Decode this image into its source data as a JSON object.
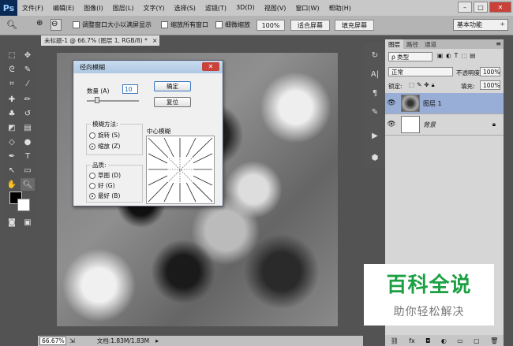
{
  "app": {
    "logo": "Ps",
    "menu": [
      "文件(F)",
      "编辑(E)",
      "图像(I)",
      "图层(L)",
      "文字(Y)",
      "选择(S)",
      "滤镜(T)",
      "3D(D)",
      "视图(V)",
      "窗口(W)",
      "帮助(H)"
    ],
    "window_controls": {
      "minimize": "–",
      "restore": "□",
      "close": "✕"
    }
  },
  "options": {
    "resize_windows": "调整窗口大小以满屏显示",
    "zoom_all": "缩放所有窗口",
    "scrubby_zoom": "细微缩放",
    "btn_100": "100%",
    "btn_fit": "适合屏幕",
    "btn_fill": "填充屏幕",
    "workspace": "基本功能"
  },
  "document": {
    "tab_title": "未标题-1 @ 66.7% (图层 1, RGB/8) *",
    "tab_close": "×",
    "zoom": "66.67%",
    "doc_info": "文档:1.83M/1.83M"
  },
  "layers_panel": {
    "tabs": [
      "图层",
      "路径",
      "通道"
    ],
    "filter_kind": "ρ 类型",
    "blend_mode": "正常",
    "opacity_label": "不透明度:",
    "opacity_value": "100%",
    "lock_label": "锁定:",
    "fill_label": "填充:",
    "fill_value": "100%",
    "layers": [
      {
        "name": "图层 1",
        "selected": true
      },
      {
        "name": "背景",
        "selected": false,
        "locked": true
      }
    ],
    "footer_icons": [
      "link-icon",
      "fx-icon",
      "mask-icon",
      "adjustment-icon",
      "folder-icon",
      "new-layer-icon",
      "trash-icon"
    ]
  },
  "dialog": {
    "title": "径向模糊",
    "amount_label": "数量 (A)",
    "amount_value": "10",
    "ok": "确定",
    "reset": "复位",
    "method_label": "模糊方法:",
    "method_spin": "旋转 (S)",
    "method_zoom": "缩放 (Z)",
    "quality_label": "品质:",
    "q_draft": "草图 (D)",
    "q_good": "好 (G)",
    "q_best": "最好 (B)",
    "center_label": "中心模糊"
  },
  "watermark": {
    "title": "百科全说",
    "subtitle": "助你轻松解决"
  },
  "colors": {
    "accent_selected_layer": "#98aed6",
    "watermark_green": "#1da043",
    "dialog_close": "#c9423a"
  }
}
